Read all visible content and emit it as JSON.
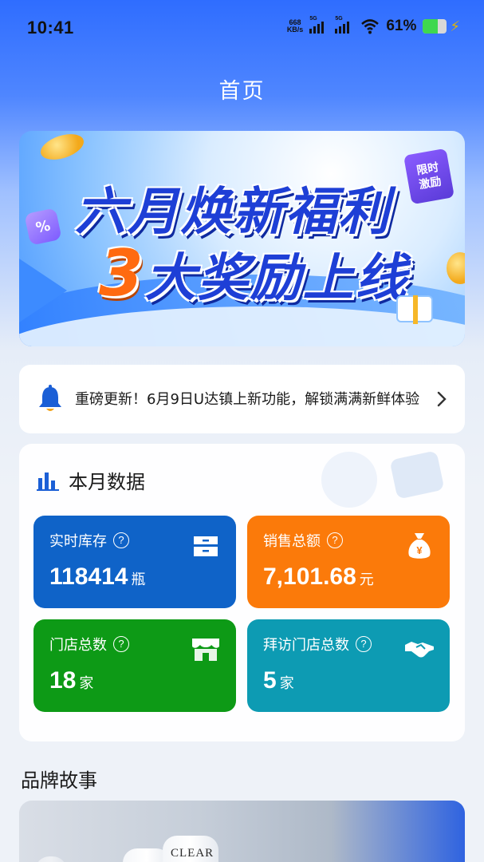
{
  "status_bar": {
    "time": "10:41",
    "net_speed_value": "668",
    "net_speed_unit": "KB/s",
    "sim1": "5G",
    "sim2": "5G",
    "battery": "61%"
  },
  "header": {
    "title": "首页"
  },
  "banner": {
    "line1": "六月焕新福利",
    "line2_num": "3",
    "line2_rest": "大奖励上线",
    "badge_top": "限时",
    "badge_bottom": "激励",
    "pct_symbol": "%"
  },
  "notice": {
    "text": "重磅更新！6月9日U达镇上新功能，解锁满满新鲜体验"
  },
  "monthly": {
    "title": "本月数据",
    "tiles": [
      {
        "label": "实时库存",
        "help": "?",
        "value": "118414",
        "unit": "瓶",
        "icon": "inventory-box-icon"
      },
      {
        "label": "销售总额",
        "help": "?",
        "value": "7,101.68",
        "unit": "元",
        "icon": "money-bag-icon"
      },
      {
        "label": "门店总数",
        "help": "?",
        "value": "18",
        "unit": "家",
        "icon": "store-icon"
      },
      {
        "label": "拜访门店总数",
        "help": "?",
        "value": "5",
        "unit": "家",
        "icon": "handshake-icon"
      }
    ],
    "colors": {
      "inventory": "#0f63c8",
      "sales": "#fb7a0a",
      "stores": "#0d9a16",
      "visits": "#0d9bb3"
    }
  },
  "brand_story": {
    "title": "品牌故事",
    "logo_text": "CLEAR"
  }
}
